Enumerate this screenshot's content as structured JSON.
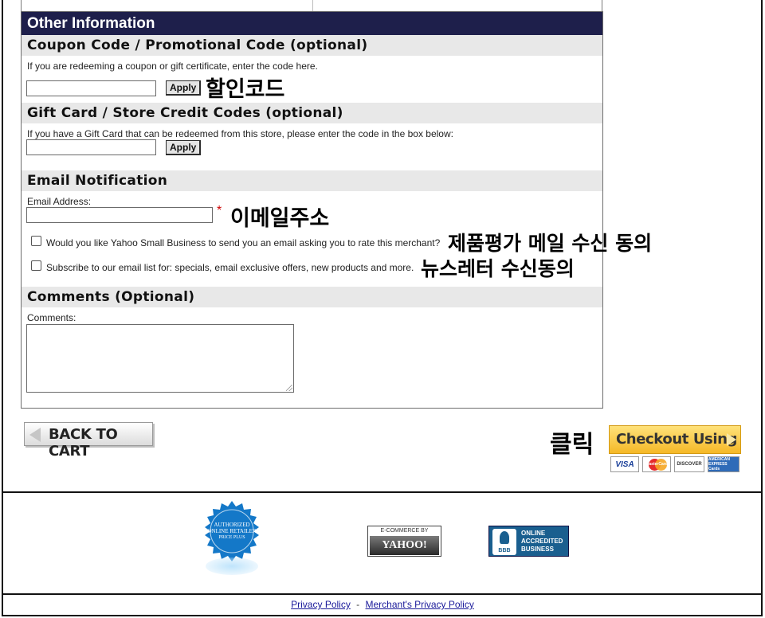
{
  "panel": {
    "title": "Other Information"
  },
  "coupon": {
    "heading": "Coupon Code / Promotional Code (optional)",
    "hint": "If you are redeeming a coupon or gift certificate, enter the code here.",
    "value": "",
    "apply_label": "Apply"
  },
  "gift_card": {
    "heading": "Gift Card / Store Credit Codes (optional)",
    "hint": "If you have a Gift Card that can be redeemed from this store, please enter the code in the box below:",
    "value": "",
    "apply_label": "Apply"
  },
  "email": {
    "heading": "Email Notification",
    "address_label": "Email Address:",
    "value": "",
    "required_mark": "*",
    "rate_merchant_label": "Would you like Yahoo Small Business to send you an email asking you to rate this merchant?",
    "rate_merchant_checked": false,
    "subscribe_label": "Subscribe to our email list for: specials, email exclusive offers, new products and more.",
    "subscribe_checked": false
  },
  "comments": {
    "heading": "Comments (Optional)",
    "label": "Comments:",
    "value": ""
  },
  "annotations": {
    "coupon": "할인코드",
    "email": "이메일주소",
    "review": "제품평가 메일 수신 동의",
    "newsletter": "뉴스레터 수신동의",
    "click": "클릭"
  },
  "actions": {
    "back_to_cart": "BACK TO CART",
    "checkout": "Checkout Using"
  },
  "payment_cards": [
    "VISA",
    "MasterCard",
    "DISCOVER",
    "AMERICAN EXPRESS Cards"
  ],
  "badges": {
    "seal_lines": [
      "AUTHORIZED",
      "ONLINE RETAILER",
      "PRICE PLUS"
    ],
    "yahoo_top": "E-COMMERCE BY",
    "yahoo_main": "YAHOO!",
    "bbb_logo": "BBB",
    "bbb_lines": [
      "ONLINE",
      "ACCREDITED",
      "BUSINESS"
    ]
  },
  "footer": {
    "privacy": "Privacy Policy",
    "separator": "-",
    "merchant_privacy": "Merchant's Privacy Policy"
  },
  "colors": {
    "panel_header": "#1e1f4b",
    "section_bg": "#e8e8e8",
    "checkout_yellow": "#f5b827",
    "link": "#1a1a9a",
    "bbb_blue": "#1a5f8f"
  }
}
